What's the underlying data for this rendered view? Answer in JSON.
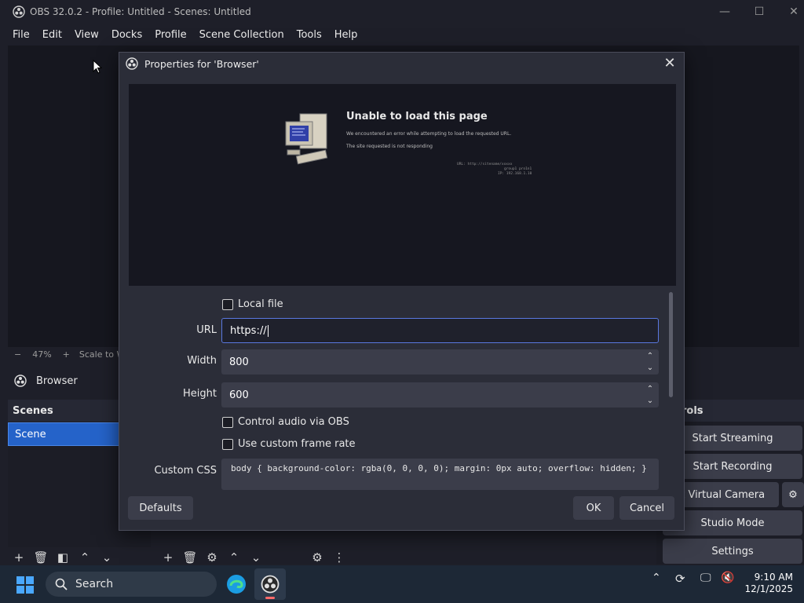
{
  "window": {
    "title": "OBS 32.0.2 - Profile: Untitled - Scenes: Untitled",
    "minimize": "—",
    "maximize": "☐",
    "close": "✕"
  },
  "menubar": {
    "items": [
      "File",
      "Edit",
      "View",
      "Docks",
      "Profile",
      "Scene Collection",
      "Tools",
      "Help"
    ]
  },
  "preview_bar": {
    "minus": "−",
    "zoom": "47%",
    "plus": "+",
    "scale": "Scale to W"
  },
  "source": {
    "name": "Browser"
  },
  "scenes_dock": {
    "title": "Scenes",
    "items": [
      "Scene"
    ]
  },
  "controls_dock": {
    "title": "rols",
    "buttons": [
      "Start Streaming",
      "Start Recording",
      "rt Virtual Camera",
      "Studio Mode",
      "Settings"
    ]
  },
  "dialog": {
    "title": "Properties for 'Browser'",
    "close": "✕",
    "error_page": {
      "heading": "Unable to load this page",
      "message": "We encountered an error while attempting to load the requested URL.",
      "detail": "The site requested is not responding",
      "meta_line1": "URL: http://sitename/xxxxx",
      "meta_line2": "group1 pro1n1",
      "meta_line3": "IP: 192.168.1.10"
    },
    "fields": {
      "local_file": "Local file",
      "url_label": "URL",
      "url_value": "https://",
      "width_label": "Width",
      "width_value": "800",
      "height_label": "Height",
      "height_value": "600",
      "control_audio": "Control audio via OBS",
      "custom_frame_rate": "Use custom frame rate",
      "custom_css_label": "Custom CSS",
      "custom_css_value": "body { background-color: rgba(0, 0, 0, 0); margin: 0px auto; overflow: hidden; }"
    },
    "buttons": {
      "defaults": "Defaults",
      "ok": "OK",
      "cancel": "Cancel"
    }
  },
  "taskbar": {
    "search": "Search",
    "time": "9:10 AM",
    "date": "12/1/2025"
  },
  "colors": {
    "accent": "#2563c9",
    "background": "#1e1f29",
    "dialog": "#2b2d38",
    "input": "#3b3d4a"
  }
}
